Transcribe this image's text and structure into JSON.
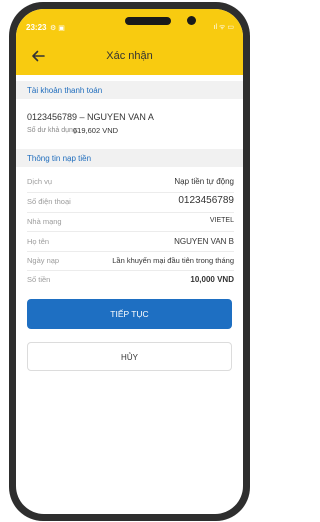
{
  "status_bar": {
    "time": "23:23",
    "left_icons": "⚙ ▣",
    "right_icons": "ıl ᯤ ▭"
  },
  "header": {
    "title": "Xác nhận"
  },
  "account_section": {
    "heading": "Tài khoản thanh toán",
    "account_name": "0123456789 – NGUYEN VAN A",
    "balance_label": "Số dư khả dụng:",
    "balance_value": "619,602 VND"
  },
  "topup_section": {
    "heading": "Thông tin nạp tiền",
    "rows": [
      {
        "label": "Dịch vụ",
        "value": "Nạp tiền tự động"
      },
      {
        "label": "Số điện thoại",
        "value": "0123456789"
      },
      {
        "label": "Nhà mạng",
        "value": "VIETEL"
      },
      {
        "label": "Họ tên",
        "value": "NGUYEN VAN B"
      },
      {
        "label": "Ngày nạp",
        "value": "Lần khuyến mại đầu tiên trong tháng"
      },
      {
        "label": "Số tiền",
        "value": "10,000 VND"
      }
    ]
  },
  "actions": {
    "continue_label": "TIẾP TỤC",
    "cancel_label": "HỦY"
  },
  "colors": {
    "header": "#f8cb10",
    "primary": "#1e6fc2",
    "section_heading": "#1f6dbd",
    "frame": "#2e2e2e"
  }
}
